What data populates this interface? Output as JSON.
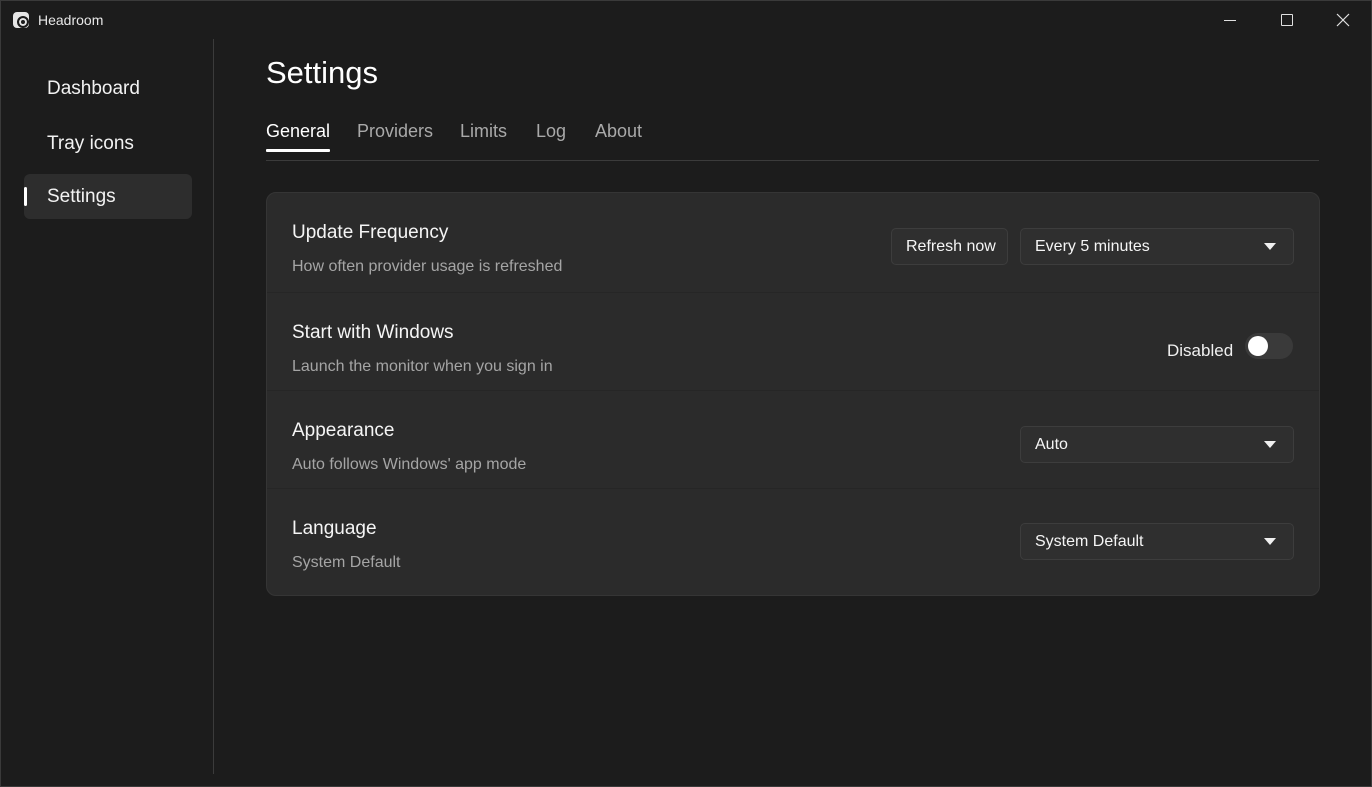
{
  "window": {
    "title": "Headroom"
  },
  "sidebar": {
    "items": [
      {
        "label": "Dashboard"
      },
      {
        "label": "Tray icons"
      },
      {
        "label": "Settings"
      }
    ]
  },
  "page": {
    "title": "Settings"
  },
  "tabs": [
    {
      "label": "General"
    },
    {
      "label": "Providers"
    },
    {
      "label": "Limits"
    },
    {
      "label": "Log"
    },
    {
      "label": "About"
    }
  ],
  "settings": {
    "update_frequency": {
      "title": "Update Frequency",
      "description": "How often provider usage is refreshed",
      "button_label": "Refresh now",
      "selected": "Every 5 minutes"
    },
    "start_with_windows": {
      "title": "Start with Windows",
      "description": "Launch the monitor when you sign in",
      "state_label": "Disabled",
      "enabled": false
    },
    "appearance": {
      "title": "Appearance",
      "description": "Auto follows Windows' app mode",
      "selected": "Auto"
    },
    "language": {
      "title": "Language",
      "description": "System Default",
      "selected": "System Default"
    }
  },
  "colors": {
    "background": "#1c1c1c",
    "card": "#2b2b2b",
    "accent": "#ffffff"
  }
}
